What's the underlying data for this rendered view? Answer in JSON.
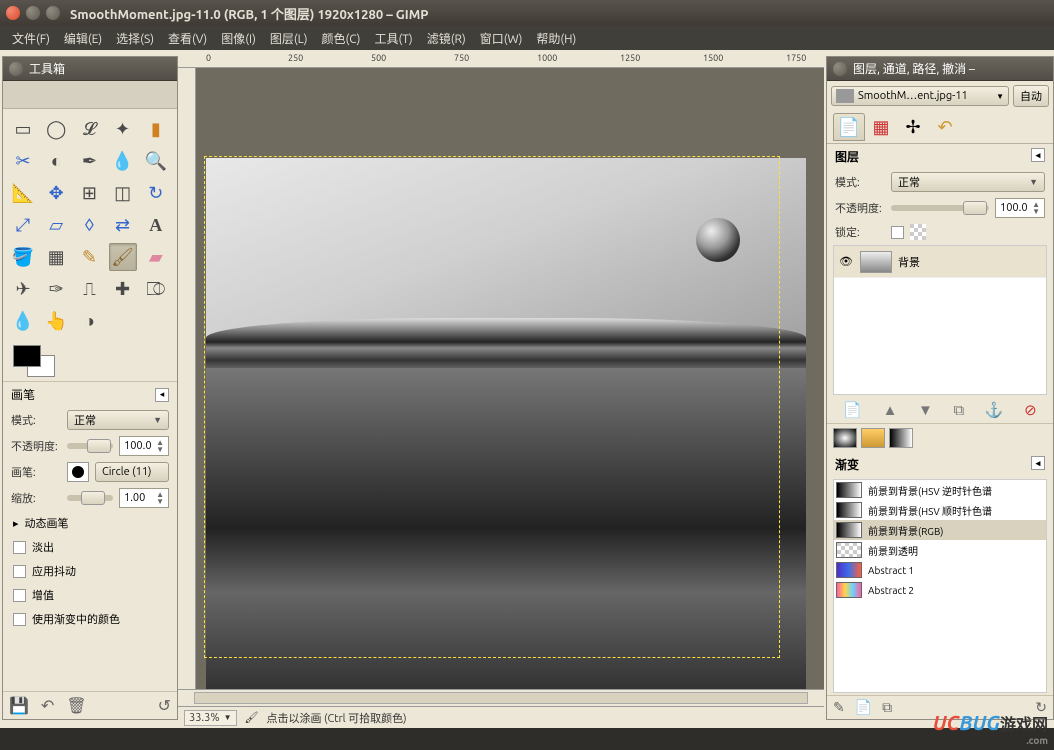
{
  "window": {
    "title": "SmoothMoment.jpg-11.0 (RGB, 1 个图层) 1920x1280 – GIMP"
  },
  "menu": {
    "file": "文件(F)",
    "edit": "编辑(E)",
    "select": "选择(S)",
    "view": "查看(V)",
    "image": "图像(I)",
    "layer": "图层(L)",
    "color": "颜色(C)",
    "tools": "工具(T)",
    "filters": "滤镜(R)",
    "window": "窗口(W)",
    "help": "帮助(H)"
  },
  "toolbox": {
    "title": "工具箱",
    "fg_color": "#000000",
    "bg_color": "#FFFFFF"
  },
  "tool_options": {
    "header": "画笔",
    "mode_label": "模式:",
    "mode_value": "正常",
    "opacity_label": "不透明度:",
    "opacity_value": "100.0",
    "brush_label": "画笔:",
    "brush_value": "Circle (11)",
    "scale_label": "缩放:",
    "scale_value": "1.00",
    "dynamic_expand": "动态画笔",
    "fade_label": "淡出",
    "jitter_label": "应用抖动",
    "incremental_label": "增值",
    "use_gradient_label": "使用渐变中的颜色"
  },
  "canvas": {
    "ruler_marks": [
      "0",
      "250",
      "500",
      "750",
      "1000",
      "1250",
      "1500",
      "1750"
    ]
  },
  "statusbar": {
    "zoom": "33.3%",
    "hint": "点击以涂画 (Ctrl 可拾取颜色)"
  },
  "right_panel": {
    "title": "图层, 通道, 路径, 撤消 –",
    "doc_tab": "SmoothM…ent.jpg-11",
    "auto": "自动",
    "layers_header": "图层",
    "mode_label": "模式:",
    "mode_value": "正常",
    "opacity_label": "不透明度:",
    "opacity_value": "100.0",
    "lock_label": "锁定:",
    "layer_name": "背景",
    "gradients_header": "渐变",
    "gradients": [
      "前景到背景(HSV 逆时针色谱",
      "前景到背景(HSV 顺时针色谱",
      "前景到背景(RGB)",
      "前景到透明",
      "Abstract 1",
      "Abstract 2"
    ]
  },
  "watermark": {
    "brand_a": "UC",
    "brand_b": "BUG",
    "suffix": "游戏网",
    "domain": ".com"
  }
}
